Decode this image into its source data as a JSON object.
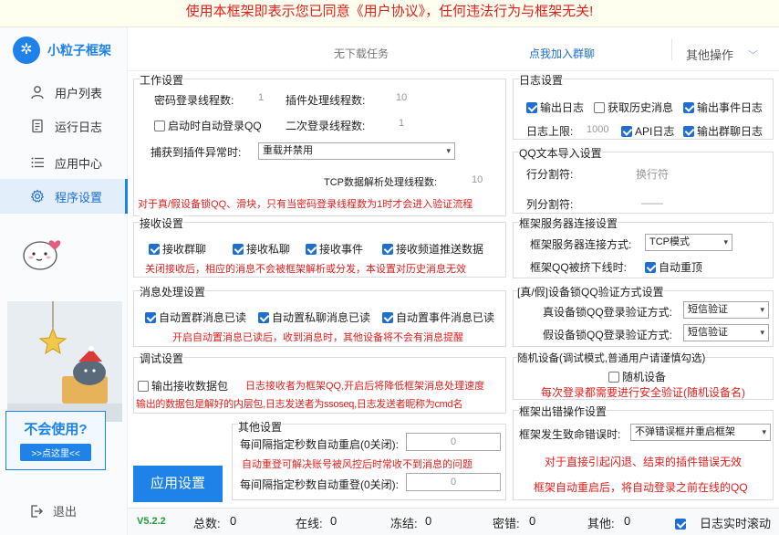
{
  "banner": "使用本框架即表示您已同意《用户协议》，任何违法行为与框架无关!",
  "brand": {
    "logo": "✲",
    "name": "小粒子框架"
  },
  "nav": [
    {
      "label": "用户列表",
      "icon": "user-icon"
    },
    {
      "label": "运行日志",
      "icon": "document-icon"
    },
    {
      "label": "应用中心",
      "icon": "list-icon"
    },
    {
      "label": "程序设置",
      "icon": "gear-icon"
    }
  ],
  "help": {
    "title": "不会使用?",
    "button": ">>点这里<<"
  },
  "exit_label": "退出",
  "topbar": {
    "no_task": "无下载任务",
    "join": "点我加入群聊",
    "other": "其他操作"
  },
  "work": {
    "title": "工作设置",
    "pwd_threads_label": "密码登录线程数:",
    "pwd_threads": "1",
    "plugin_threads_label": "插件处理线程数:",
    "plugin_threads": "10",
    "auto_login_label": "启动时自动登录QQ",
    "second_threads_label": "二次登录线程数:",
    "second_threads": "1",
    "exception_label": "捕获到插件异常时:",
    "exception_value": "重载并禁用",
    "tcp_threads_label": "TCP数据解析处理线程数:",
    "tcp_threads": "10",
    "warning": "对于真/假设备锁QQ、滑块，只有当密码登录线程数为1时才会进入验证流程"
  },
  "receive": {
    "title": "接收设置",
    "items": [
      "接收群聊",
      "接收私聊",
      "接收事件",
      "接收频道推送数据"
    ],
    "warning": "关闭接收后，相应的消息不会被框架解析或分发，本设置对历史消息无效"
  },
  "message": {
    "title": "消息处理设置",
    "items": [
      "自动置群消息已读",
      "自动置私聊消息已读",
      "自动置事件消息已读"
    ],
    "warning": "开启自动置消息已读后，收到消息时，其他设备将不会有消息提醒"
  },
  "debug": {
    "title": "调试设置",
    "output_label": "输出接收数据包",
    "note1": "日志接收者为框架QQ,开启后将降低框架消息处理速度",
    "note2": "输出的数据包是解好的内层包,日志发送者为ssoseq,日志发送者昵称为cmd名"
  },
  "other": {
    "title": "其他设置",
    "restart_label": "每间隔指定秒数自动重启(0关闭):",
    "restart_value": "0",
    "warning": "自动重登可解决账号被风控后时常收不到消息的问题",
    "relogin_label": "每间隔指定秒数自动重登(0关闭):",
    "relogin_value": "0"
  },
  "apply_button": "应用设置",
  "log": {
    "title": "日志设置",
    "output_log": "输出日志",
    "history": "获取历史消息",
    "event_log": "输出事件日志",
    "limit_label": "日志上限:",
    "limit_value": "1000",
    "api_log": "API日志",
    "group_log": "输出群聊日志"
  },
  "qqimport": {
    "title": "QQ文本导入设置",
    "row_label": "行分割符:",
    "row_value": "换行符",
    "col_label": "列分割符:",
    "col_value": "——"
  },
  "server": {
    "title": "框架服务器连接设置",
    "mode_label": "框架服务器连接方式:",
    "mode_value": "TCP模式",
    "kicked_label": "框架QQ被挤下线时:",
    "kicked_option": "自动重顶"
  },
  "devlock": {
    "title": "[真/假]设备锁QQ验证方式设置",
    "real_label": "真设备锁QQ登录验证方式:",
    "real_value": "短信验证",
    "fake_label": "假设备锁QQ登录验证方式:",
    "fake_value": "短信验证"
  },
  "random": {
    "title": "随机设备(调试模式,普通用户请谨慎勾选)",
    "label": "随机设备",
    "warning": "每次登录都需要进行安全验证(随机设备名)"
  },
  "error": {
    "title": "框架出错操作设置",
    "fatal_label": "框架发生致命错误时:",
    "fatal_value": "不弹错误框并重启框架",
    "note1": "对于直接引起闪退、结束的插件错误无效",
    "note2": "框架自动重启后，将自动登录之前在线的QQ"
  },
  "status": {
    "version": "V5.2.2",
    "total_label": "总数:",
    "total": "0",
    "online_label": "在线:",
    "online": "0",
    "frozen_label": "冻结:",
    "frozen": "0",
    "pwderr_label": "密错:",
    "pwderr": "0",
    "other_label": "其他:",
    "other": "0",
    "realtime_label": "日志实时滚动"
  }
}
